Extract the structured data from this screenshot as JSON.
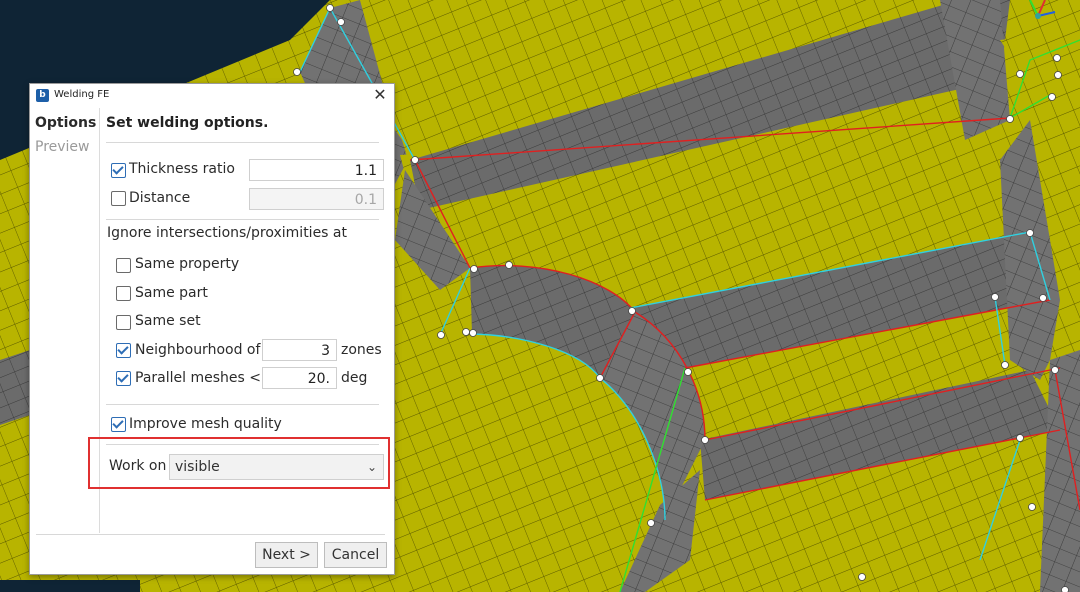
{
  "dialog": {
    "title": "Welding FE",
    "app_icon_glyph": "b",
    "close_glyph": "✕",
    "nav": [
      {
        "label": "Options",
        "active": true
      },
      {
        "label": "Preview",
        "active": false
      }
    ],
    "heading": "Set welding options.",
    "thickness_ratio": {
      "label": "Thickness ratio",
      "checked": true,
      "value": "1.1"
    },
    "distance": {
      "label": "Distance",
      "checked": false,
      "value": "0.1"
    },
    "ignore_heading": "Ignore intersections/proximities at",
    "same_property": {
      "label": "Same property",
      "checked": false
    },
    "same_part": {
      "label": "Same part",
      "checked": false
    },
    "same_set": {
      "label": "Same set",
      "checked": false
    },
    "neighbourhood": {
      "label": "Neighbourhood of",
      "checked": true,
      "value": "3",
      "unit": "zones"
    },
    "parallel": {
      "label": "Parallel meshes <",
      "checked": true,
      "value": "20.",
      "unit": "deg"
    },
    "improve": {
      "label": "Improve mesh quality",
      "checked": true
    },
    "work_on": {
      "label": "Work on",
      "selected": "visible"
    },
    "buttons": {
      "next": "Next >",
      "cancel": "Cancel"
    }
  },
  "colors": {
    "mesh_yellow": "#b8b400",
    "flange_gray": "#6a6a6a",
    "edge_red": "#e02020",
    "edge_cyan": "#30d0e0",
    "edge_green": "#30e030",
    "background": "#0f2435",
    "highlight_red": "#e03030",
    "accent": "#2e6db5"
  },
  "icons": [
    "app-icon",
    "close-icon",
    "chevron-down-icon",
    "checkbox-icon"
  ]
}
